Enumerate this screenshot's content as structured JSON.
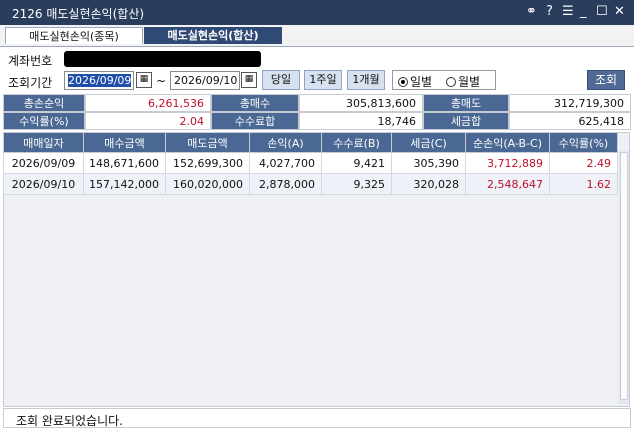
{
  "window": {
    "title": "2126 매도실현손익(합산)"
  },
  "tabs": [
    {
      "label": "매도실현손익(종목)"
    },
    {
      "label": "매도실현손익(합산)"
    }
  ],
  "account": {
    "label": "계좌번호"
  },
  "period": {
    "label": "조회기간",
    "from": "2026/09/09",
    "separator": "~",
    "to": "2026/09/10",
    "buttons": {
      "today": "당일",
      "week": "1주일",
      "month": "1개월"
    },
    "radios": {
      "daily": "일별",
      "monthly": "월별",
      "selected": "daily"
    },
    "query_label": "조회"
  },
  "summary": {
    "total_pnl_label": "총손순익",
    "total_pnl": "6,261,536",
    "total_buy_label": "총매수",
    "total_buy": "305,813,600",
    "total_sell_label": "총매도",
    "total_sell": "312,719,300",
    "return_label": "수익률(%)",
    "return": "2.04",
    "fee_label": "수수료합",
    "fee": "18,746",
    "tax_label": "세금합",
    "tax": "625,418"
  },
  "table": {
    "headers": [
      "매매일자",
      "매수금액",
      "매도금액",
      "손익(A)",
      "수수료(B)",
      "세금(C)",
      "순손익(A-B-C)",
      "수익률(%)"
    ],
    "rows": [
      [
        "2026/09/09",
        "148,671,600",
        "152,699,300",
        "4,027,700",
        "9,421",
        "305,390",
        "3,712,889",
        "2.49"
      ],
      [
        "2026/09/10",
        "157,142,000",
        "160,020,000",
        "2,878,000",
        "9,325",
        "320,028",
        "2,548,647",
        "1.62"
      ]
    ]
  },
  "status": {
    "message": "조회 완료되었습니다."
  },
  "colors": {
    "title_bar": "#2a3d5c",
    "header": "#4a6893",
    "accent": "#1f4ea8",
    "profit": "#c0102a"
  },
  "icons": [
    "link-icon",
    "help-icon",
    "menu-icon",
    "minimize-icon",
    "maximize-icon",
    "close-icon",
    "calendar-icon"
  ]
}
